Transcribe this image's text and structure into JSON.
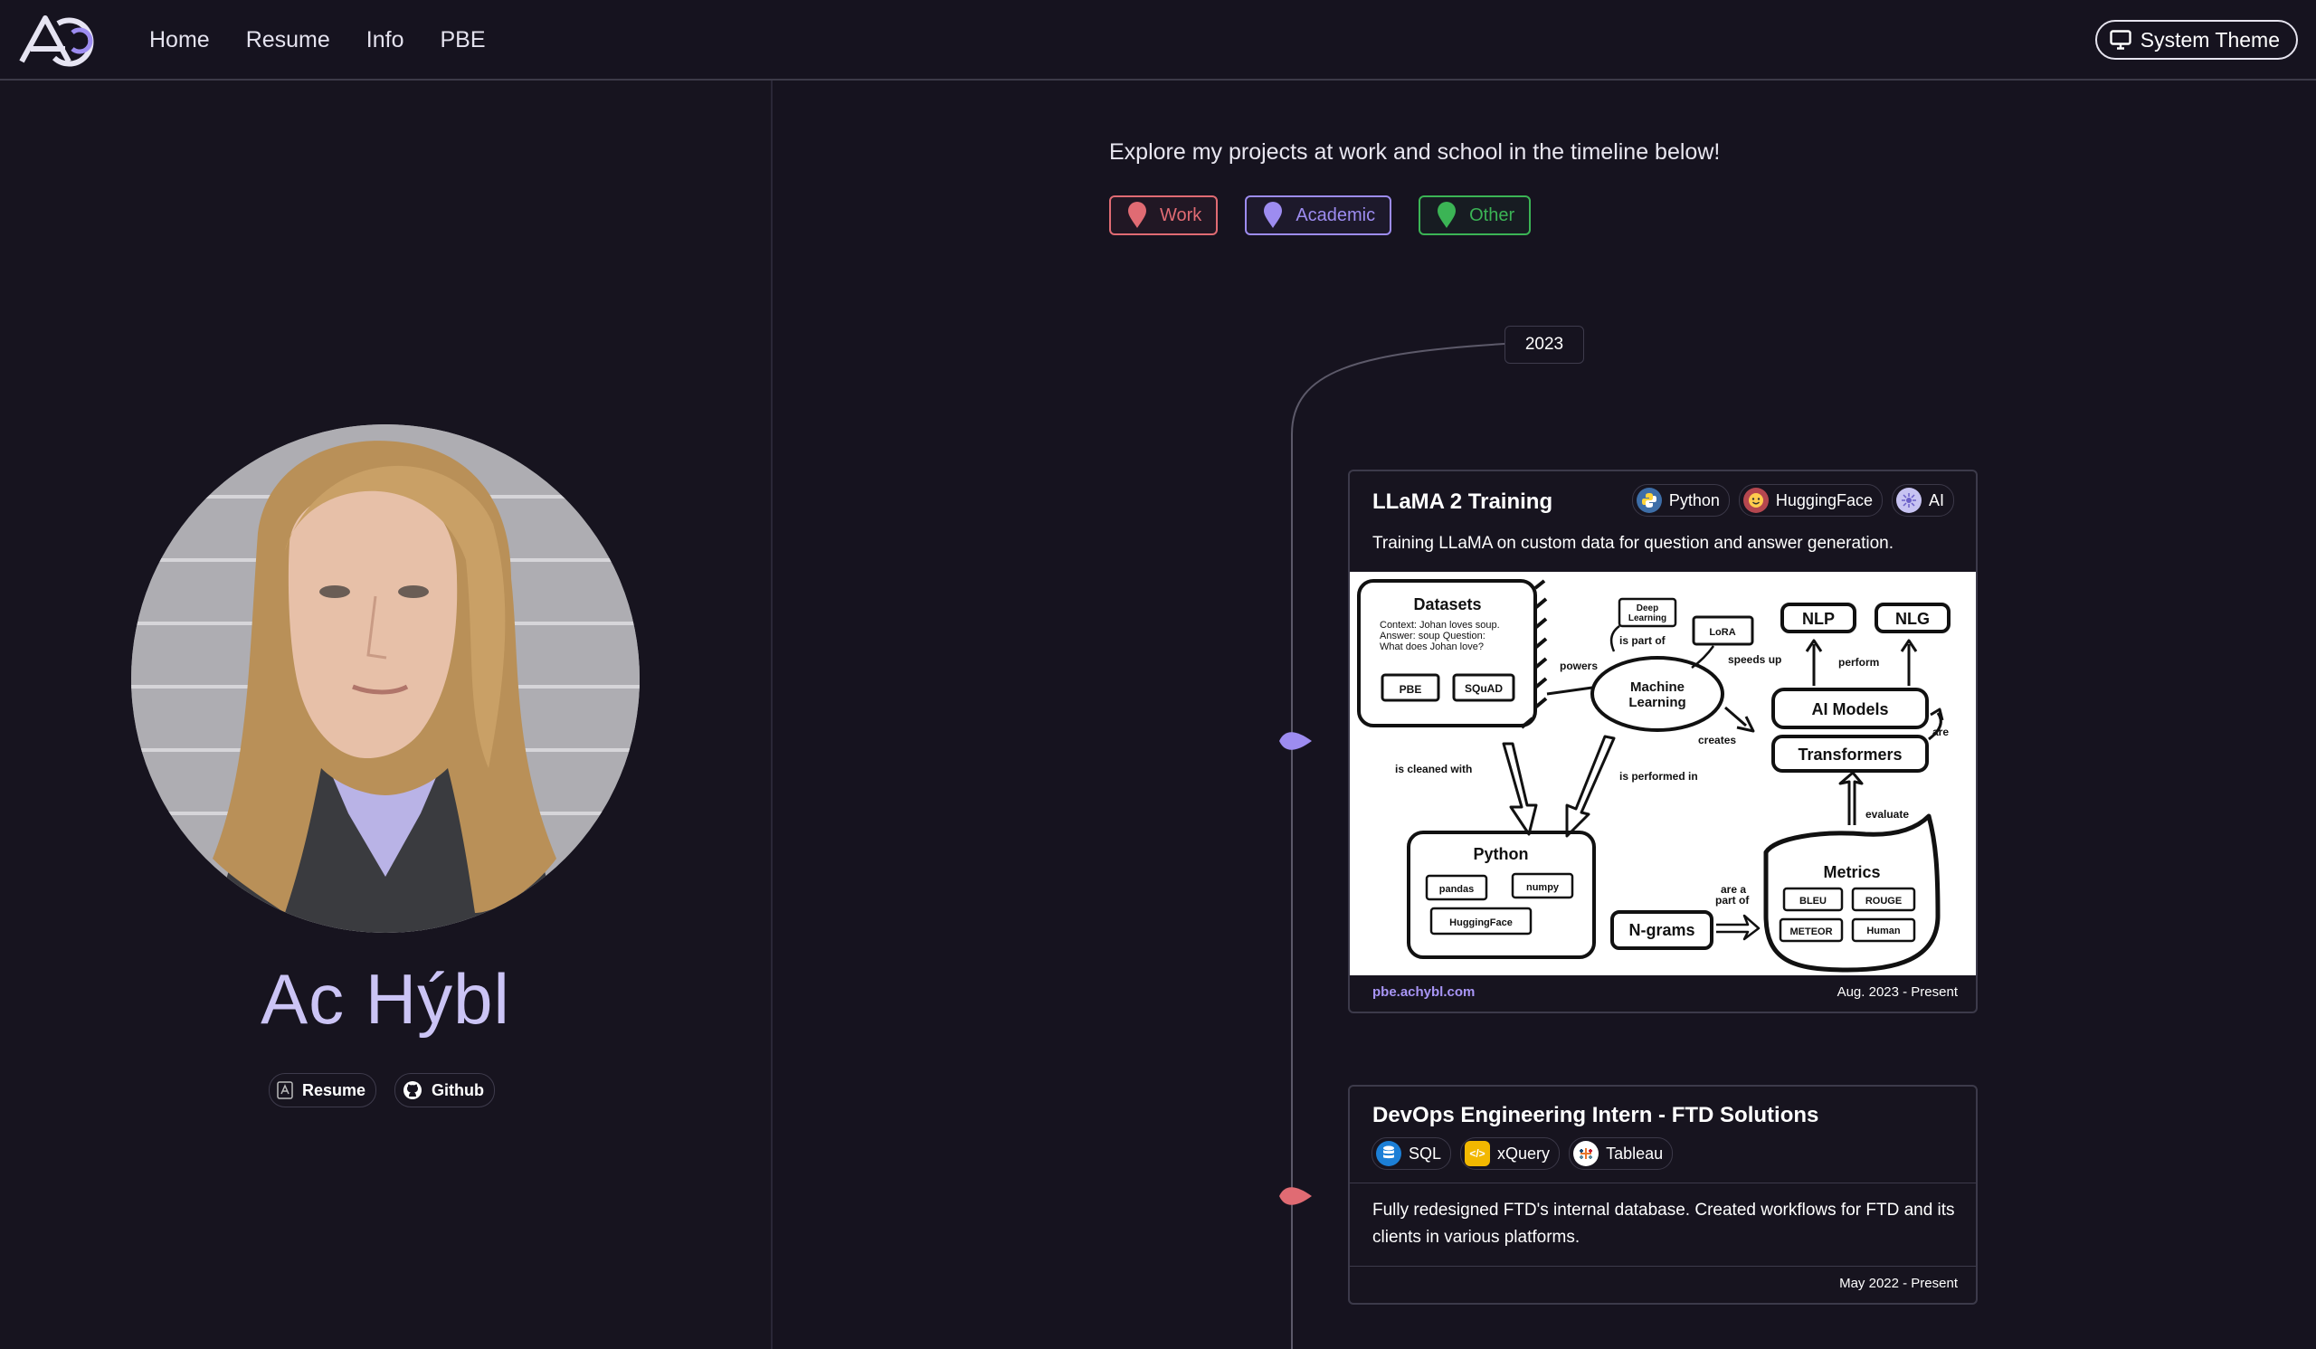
{
  "nav": {
    "items": [
      "Home",
      "Resume",
      "Info",
      "PBE"
    ],
    "theme_button": "System Theme"
  },
  "profile": {
    "name": "Ac Hýbl",
    "links": [
      {
        "label": "Resume",
        "icon": "resume-icon"
      },
      {
        "label": "Github",
        "icon": "github-icon"
      }
    ]
  },
  "timeline": {
    "intro": "Explore my projects at work and school in the timeline below!",
    "filters": [
      {
        "label": "Work",
        "color": "#e06b73"
      },
      {
        "label": "Academic",
        "color": "#9d8cf0"
      },
      {
        "label": "Other",
        "color": "#3bb455"
      }
    ],
    "year": "2023",
    "cards": [
      {
        "title": "LLaMA 2 Training",
        "category": "Academic",
        "tags": [
          {
            "label": "Python",
            "icon": "python-icon"
          },
          {
            "label": "HuggingFace",
            "icon": "huggingface-icon"
          },
          {
            "label": "AI",
            "icon": "ai-icon"
          }
        ],
        "description": "Training LLaMA on custom data for question and answer generation.",
        "link": "pbe.achybl.com",
        "date": "Aug. 2023 - Present"
      },
      {
        "title": "DevOps Engineering Intern - FTD Solutions",
        "category": "Work",
        "tags": [
          {
            "label": "SQL",
            "icon": "database-icon"
          },
          {
            "label": "xQuery",
            "icon": "code-icon"
          },
          {
            "label": "Tableau",
            "icon": "tableau-icon"
          }
        ],
        "description": "Fully redesigned FTD's internal database. Created workflows for FTD and its clients in various platforms.",
        "date": "May 2022 - Present"
      }
    ]
  },
  "diagram": {
    "datasets": "Datasets",
    "datasets_text": [
      "Context: Johan loves soup.",
      "Answer: soup Question:",
      "What does Johan love?"
    ],
    "pbe": "PBE",
    "squad": "SQuAD",
    "deep_learning": [
      "Deep",
      "Learning"
    ],
    "lora": "LoRA",
    "nlp": "NLP",
    "nlg": "NLG",
    "is_part_of": "is part of",
    "speeds_up": "speeds up",
    "perform": "perform",
    "powers": "powers",
    "machine_learning": [
      "Machine",
      "Learning"
    ],
    "creates": "creates",
    "ai_models": "AI Models",
    "are": "are",
    "transformers": "Transformers",
    "is_cleaned_with": "is cleaned with",
    "is_performed_in": "is performed in",
    "evaluate": "evaluate",
    "python": "Python",
    "pandas": "pandas",
    "numpy": "numpy",
    "huggingface": "HuggingFace",
    "ngrams": "N-grams",
    "are_a_part_of": [
      "are a",
      "part of"
    ],
    "metrics": "Metrics",
    "bleu": "BLEU",
    "rouge": "ROUGE",
    "meteor": "METEOR",
    "human": "Human"
  }
}
